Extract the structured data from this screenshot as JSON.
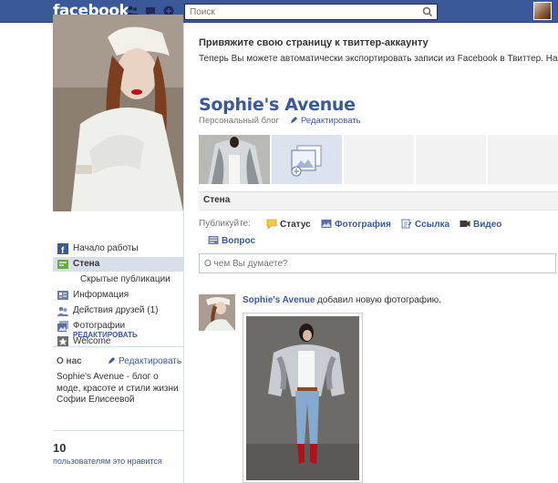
{
  "topbar": {
    "logo": "facebook",
    "search_placeholder": "Поиск"
  },
  "nav": {
    "items": [
      {
        "label": "Начало работы",
        "icon": "facebook-icon"
      },
      {
        "label": "Стена",
        "icon": "wall-icon",
        "active": true
      },
      {
        "label": "Скрытые публикации",
        "icon": ""
      },
      {
        "label": "Информация",
        "icon": "info-icon"
      },
      {
        "label": "Действия друзей (1)",
        "icon": "friends-icon"
      },
      {
        "label": "Фотографии",
        "icon": "photos-icon"
      },
      {
        "label": "Welcome",
        "icon": "star-icon"
      }
    ],
    "edit_label": "РЕДАКТИРОВАТЬ"
  },
  "about": {
    "title": "О нас",
    "edit_label": "Редактировать",
    "text": "Sophie's Avenue - блог о моде, красоте и стили жизни Софии Елисеевой"
  },
  "likes": {
    "count": "10",
    "text": "пользователям это нравится"
  },
  "banner": {
    "title": "Привяжите свою страницу к твиттер-аккаунту",
    "text": "Теперь Вы можете автоматически экспортировать записи из Facebook в Твиттер. Нажм"
  },
  "page": {
    "title": "Sophie's Avenue",
    "subtitle": "Персональный блог",
    "edit_label": "Редактировать"
  },
  "wall": {
    "tab_label": "Стена",
    "publish_label": "Публикуйте:",
    "options": [
      {
        "label": "Статус",
        "icon": "status-icon"
      },
      {
        "label": "Фотография",
        "icon": "photo-icon"
      },
      {
        "label": "Ссылка",
        "icon": "link-icon"
      },
      {
        "label": "Видео",
        "icon": "video-icon"
      },
      {
        "label": "Вопрос",
        "icon": "question-icon"
      }
    ],
    "status_placeholder": "О чем Вы думаете?"
  },
  "story": {
    "author": "Sophie's Avenue",
    "action": "добавил новую фотографию."
  },
  "colors": {
    "brand": "#3b5998",
    "nav_active": "#d8dfea"
  }
}
